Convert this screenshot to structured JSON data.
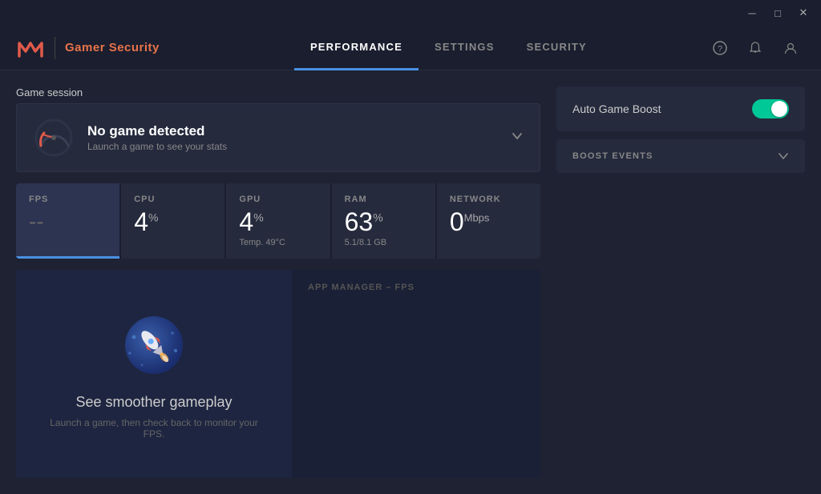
{
  "titlebar": {
    "minimize_label": "─",
    "maximize_label": "□",
    "close_label": "✕"
  },
  "header": {
    "logo_text": "Gamer Security",
    "nav": {
      "tabs": [
        {
          "id": "performance",
          "label": "PERFORMANCE",
          "active": true
        },
        {
          "id": "settings",
          "label": "SETTINGS",
          "active": false
        },
        {
          "id": "security",
          "label": "SECURITY",
          "active": false
        }
      ]
    },
    "icons": {
      "help": "?",
      "bell": "🔔",
      "user": "👤"
    }
  },
  "main": {
    "game_session": {
      "section_label": "Game session",
      "title": "No game detected",
      "subtitle": "Launch a game to see your stats"
    },
    "stats": [
      {
        "id": "fps",
        "label": "FPS",
        "value": "--",
        "is_dash": true,
        "active": true
      },
      {
        "id": "cpu",
        "label": "CPU",
        "value": "4",
        "unit": "%",
        "active": false
      },
      {
        "id": "gpu",
        "label": "GPU",
        "value": "4",
        "unit": "%",
        "sub": "Temp. 49°C",
        "active": false
      },
      {
        "id": "ram",
        "label": "RAM",
        "value": "63",
        "unit": "%",
        "sub": "5.1/8.1 GB",
        "active": false
      },
      {
        "id": "network",
        "label": "NETWORK",
        "value": "0",
        "unit": "Mbps",
        "active": false
      }
    ],
    "fps_panel": {
      "title": "See smoother gameplay",
      "description": "Launch a game, then check back to monitor your FPS."
    },
    "app_manager_label": "APP MANAGER – FPS"
  },
  "right_panel": {
    "auto_game_boost_label": "Auto Game Boost",
    "boost_events_label": "BOOST EVENTS",
    "toggle_on": true
  },
  "colors": {
    "accent_blue": "#4a90e2",
    "accent_green": "#00c896",
    "accent_red": "#e05a4a",
    "bg_dark": "#1a1e2e",
    "bg_card": "#252a3d",
    "text_muted": "#888888"
  }
}
